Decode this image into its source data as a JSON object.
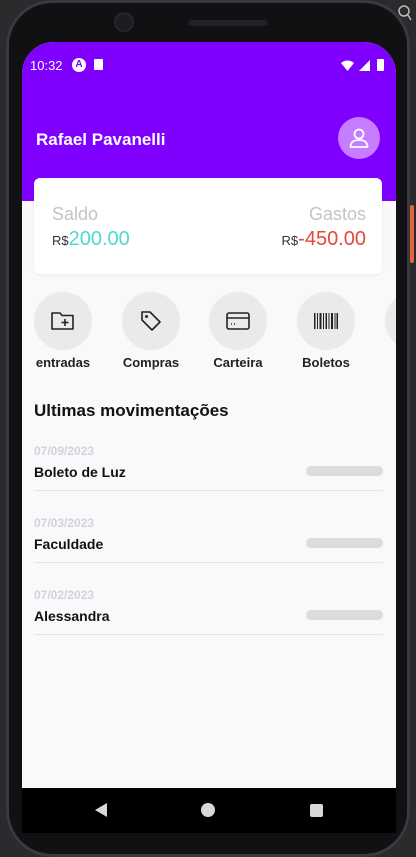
{
  "status_bar": {
    "time": "10:32",
    "a_badge": "A"
  },
  "header": {
    "user_name": "Rafael Pavanelli",
    "avatar_icon": "user-outline-icon"
  },
  "balance_card": {
    "saldo_label": "Saldo",
    "saldo_currency": "R$",
    "saldo_value": "200.00",
    "gastos_label": "Gastos",
    "gastos_currency": "R$",
    "gastos_value": "-450.00"
  },
  "actions": [
    {
      "label": "entradas",
      "icon": "folder-plus-icon"
    },
    {
      "label": "Compras",
      "icon": "tag-icon"
    },
    {
      "label": "Carteira",
      "icon": "credit-card-icon"
    },
    {
      "label": "Boletos",
      "icon": "barcode-icon"
    }
  ],
  "movements": {
    "title": "Ultimas movimentações",
    "items": [
      {
        "date": "07/09/2023",
        "name": "Boleto de Luz"
      },
      {
        "date": "07/03/2023",
        "name": "Faculdade"
      },
      {
        "date": "07/02/2023",
        "name": "Alessandra"
      }
    ]
  },
  "colors": {
    "brand": "#8000ff",
    "avatar": "#c77dff",
    "positive": "#4dd9d0",
    "negative": "#e5473b"
  }
}
